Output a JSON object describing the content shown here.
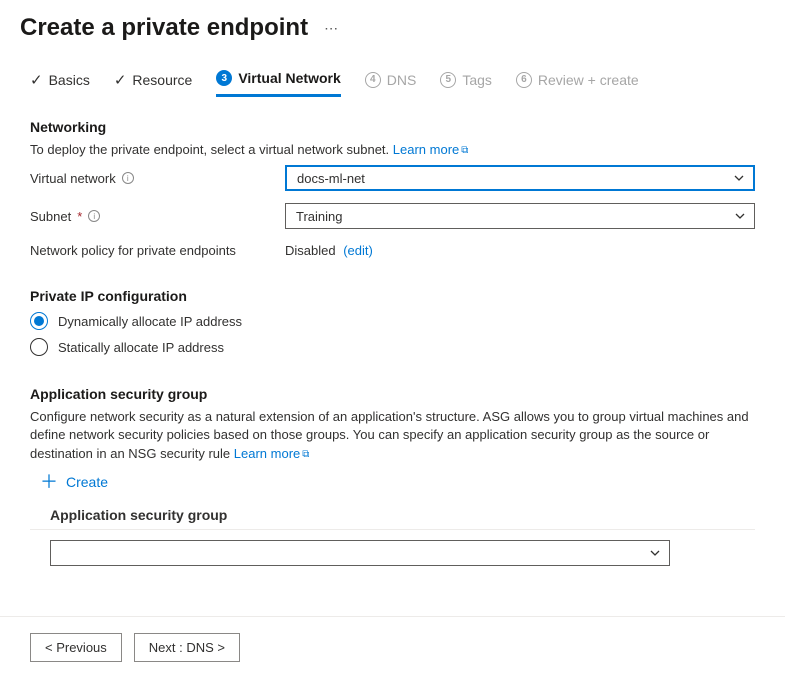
{
  "page": {
    "title": "Create a private endpoint"
  },
  "tabs": {
    "basics": "Basics",
    "resource": "Resource",
    "vnet": "Virtual Network",
    "dns_num": "4",
    "dns": "DNS",
    "tags_num": "5",
    "tags": "Tags",
    "review_num": "6",
    "review": "Review + create"
  },
  "networking": {
    "heading": "Networking",
    "desc": "To deploy the private endpoint, select a virtual network subnet. ",
    "learn_more": "Learn more",
    "vnet_label": "Virtual network",
    "vnet_value": "docs-ml-net",
    "subnet_label": "Subnet",
    "subnet_value": "Training",
    "policy_label": "Network policy for private endpoints",
    "policy_value": "Disabled",
    "edit_link": "(edit)"
  },
  "ipconfig": {
    "heading": "Private IP configuration",
    "dynamic": "Dynamically allocate IP address",
    "static": "Statically allocate IP address"
  },
  "asg": {
    "heading": "Application security group",
    "desc": "Configure network security as a natural extension of an application's structure. ASG allows you to group virtual machines and define network security policies based on those groups. You can specify an application security group as the source or destination in an NSG security rule ",
    "learn_more": "Learn more",
    "create": "Create",
    "col_header": "Application security group"
  },
  "footer": {
    "prev": "< Previous",
    "next": "Next : DNS >"
  }
}
